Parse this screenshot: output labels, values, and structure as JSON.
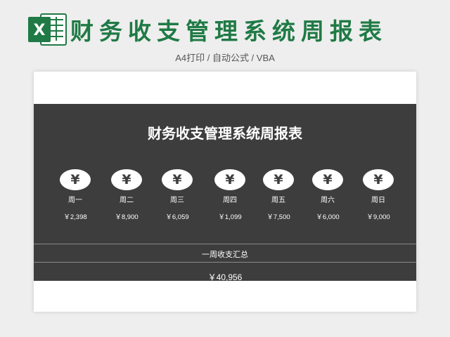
{
  "banner": {
    "logo_letter": "X",
    "title": "财务收支管理系统周报表",
    "subtitle": "A4打印 / 自动公式 / VBA"
  },
  "sheet": {
    "title": "财务收支管理系统周报表",
    "currency_symbol": "¥",
    "days": [
      {
        "label": "周一",
        "amount": "￥2,398"
      },
      {
        "label": "周二",
        "amount": "￥8,900"
      },
      {
        "label": "周三",
        "amount": "￥6,059"
      },
      {
        "label": "周四",
        "amount": "￥1,099"
      },
      {
        "label": "周五",
        "amount": "￥7,500"
      },
      {
        "label": "周六",
        "amount": "￥6,000"
      },
      {
        "label": "周日",
        "amount": "￥9,000"
      }
    ],
    "summary_label": "一周收支汇总",
    "summary_total": "￥40,956"
  },
  "colors": {
    "brand_green": "#1f7a45",
    "panel_bg": "#3d3d3d",
    "page_bg": "#eeeeee"
  }
}
